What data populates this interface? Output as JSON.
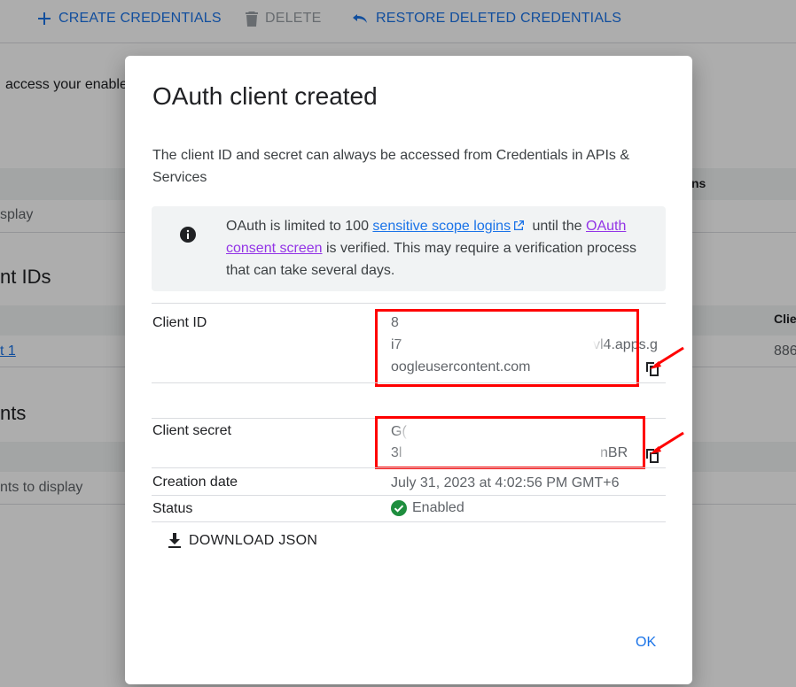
{
  "toolbar": {
    "create_label": "CREATE CREDENTIALS",
    "delete_label": "DELETE",
    "restore_label": "RESTORE DELETED CREDENTIALS"
  },
  "background": {
    "access_text": "access your enable",
    "column_fragment": "ns",
    "display_fragment": "splay",
    "section_client_ids": "nt IDs",
    "column_client": "Clie",
    "client_link": "t 1",
    "client_number": "886",
    "section_nts": "nts",
    "empty_text": "nts to display"
  },
  "dialog": {
    "title": "OAuth client created",
    "intro": "The client ID and secret can always be accessed from Credentials in APIs & Services",
    "info": {
      "text_1": "OAuth is limited to 100 ",
      "link_1": "sensitive scope logins",
      "text_2": " until the ",
      "link_2": "OAuth consent screen",
      "text_3": " is verified. This may require a verification process that can take several days."
    },
    "client_id": {
      "label": "Client ID",
      "line_1": "8",
      "line_2_start": "i7",
      "line_2_end": "vl4.apps.g",
      "line_3": "oogleusercontent.com"
    },
    "client_secret": {
      "label": "Client secret",
      "line_1": "G(",
      "line_2_start": "3l",
      "line_2_end": "nBR"
    },
    "creation_date": {
      "label": "Creation date",
      "value": "July 31, 2023 at 4:02:56 PM GMT+6"
    },
    "status": {
      "label": "Status",
      "value": "Enabled"
    },
    "download_label": "DOWNLOAD JSON",
    "ok_label": "OK"
  },
  "colors": {
    "accent": "#1a73e8",
    "visited_link": "#9334e6",
    "annotation_red": "#ff0000",
    "enabled_green": "#1e8e3e"
  }
}
